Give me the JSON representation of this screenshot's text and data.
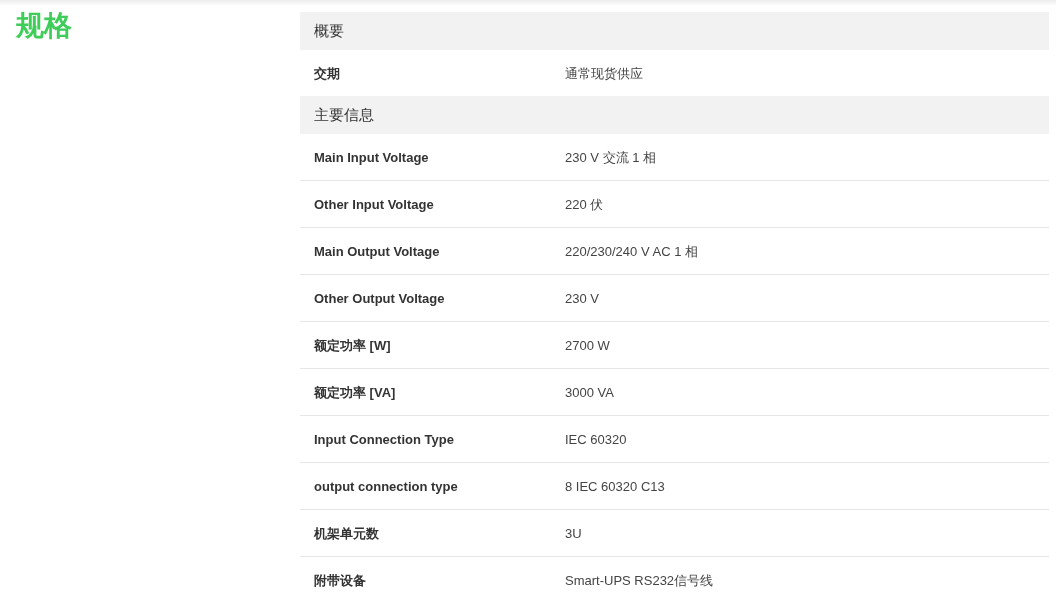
{
  "title": "规格",
  "sections": [
    {
      "heading": "概要",
      "rows": [
        {
          "label": "交期",
          "value": "通常现货供应"
        }
      ]
    },
    {
      "heading": "主要信息",
      "rows": [
        {
          "label": "Main Input Voltage",
          "value": "230 V 交流 1 相"
        },
        {
          "label": "Other Input Voltage",
          "value": "220 伏"
        },
        {
          "label": "Main Output Voltage",
          "value": "220/230/240 V AC 1 相"
        },
        {
          "label": "Other Output Voltage",
          "value": "230 V"
        },
        {
          "label": "额定功率 [W]",
          "value": "2700 W"
        },
        {
          "label": "额定功率 [VA]",
          "value": "3000 VA"
        },
        {
          "label": "Input Connection Type",
          "value": "IEC 60320"
        },
        {
          "label": "output connection type",
          "value": "8 IEC 60320 C13"
        },
        {
          "label": "机架单元数",
          "value": "3U"
        },
        {
          "label": "附带设备",
          "value": "Smart-UPS RS232信号线"
        }
      ]
    }
  ]
}
